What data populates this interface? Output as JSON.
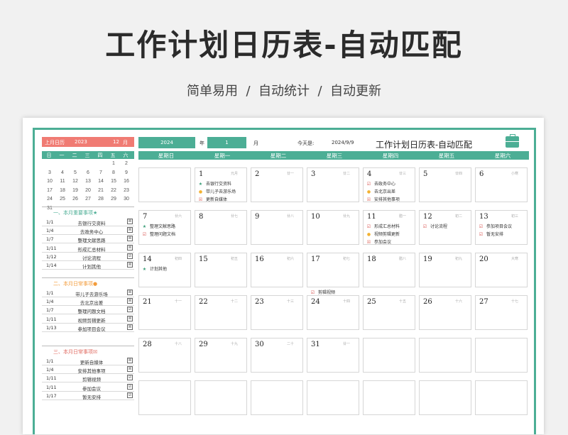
{
  "hero": {
    "title": "工作计划日历表-自动匹配",
    "subtitle": "简单易用  /  自动统计  /  自动更新"
  },
  "mini_calendar": {
    "header_label": "上月日历",
    "header_year": "2023",
    "header_month": "12",
    "header_month_unit": "月",
    "weekdays": [
      "日",
      "一",
      "二",
      "三",
      "四",
      "五",
      "六"
    ],
    "rows": [
      [
        "",
        "",
        "",
        "",
        "",
        "1",
        "2"
      ],
      [
        "3",
        "4",
        "5",
        "6",
        "7",
        "8",
        "9"
      ],
      [
        "10",
        "11",
        "12",
        "13",
        "14",
        "15",
        "16"
      ],
      [
        "17",
        "18",
        "19",
        "20",
        "21",
        "22",
        "23"
      ],
      [
        "24",
        "25",
        "26",
        "27",
        "28",
        "29",
        "30"
      ],
      [
        "31",
        "",
        "",
        "",
        "",
        "",
        ""
      ]
    ]
  },
  "sections": [
    {
      "title": "一、本月重要事项★",
      "color": "#4cae95",
      "items": [
        {
          "date": "1/1",
          "task": "去银行交资料",
          "check": "☒"
        },
        {
          "date": "1/4",
          "task": "去政务中心",
          "check": "☒"
        },
        {
          "date": "1/7",
          "task": "整理文献思路",
          "check": "☒"
        },
        {
          "date": "1/11",
          "task": "形成汇总材料",
          "check": "☒"
        },
        {
          "date": "1/12",
          "task": "讨论流程",
          "check": "☑"
        },
        {
          "date": "1/14",
          "task": "计划其他",
          "check": "☒"
        }
      ]
    },
    {
      "title": "二、本月日常事项●",
      "color": "#f39c3b",
      "items": [
        {
          "date": "1/1",
          "task": "带儿子去游乐场",
          "check": "☒"
        },
        {
          "date": "1/4",
          "task": "去北京出差",
          "check": "☒"
        },
        {
          "date": "1/7",
          "task": "整理问题文档",
          "check": "☑"
        },
        {
          "date": "1/11",
          "task": "视频剪辑更新",
          "check": "☒"
        },
        {
          "date": "1/13",
          "task": "参加项目会议",
          "check": "☒"
        }
      ]
    },
    {
      "title": "三、本月日常事项☒",
      "color": "#e06b62",
      "items": [
        {
          "date": "1/1",
          "task": "更新自媒体",
          "check": "☒"
        },
        {
          "date": "1/4",
          "task": "安排其他事项",
          "check": "☒"
        },
        {
          "date": "1/11",
          "task": "剪辑视频",
          "check": "☑"
        },
        {
          "date": "1/11",
          "task": "参加会议",
          "check": "☑"
        },
        {
          "date": "1/17",
          "task": "暂无安排",
          "check": "☑"
        }
      ]
    }
  ],
  "topbar": {
    "year": "2024",
    "year_unit": "年",
    "month": "1",
    "month_unit": "月",
    "today_label": "今天是:",
    "today_value": "2024/9/9",
    "title": "工作计划日历表-自动匹配"
  },
  "weekdays": [
    "星期日",
    "星期一",
    "星期二",
    "星期三",
    "星期四",
    "星期五",
    "星期六"
  ],
  "weeks": [
    [
      {
        "num": "",
        "lunar": "",
        "events": []
      },
      {
        "num": "1",
        "lunar": "元月",
        "events": [
          {
            "icon": "★",
            "kind": "star",
            "text": "去银行交资料"
          },
          {
            "icon": "●",
            "kind": "dot",
            "text": "带儿子去游乐场"
          },
          {
            "icon": "☒",
            "kind": "x",
            "text": "更新自媒体"
          }
        ]
      },
      {
        "num": "2",
        "lunar": "廿一",
        "events": []
      },
      {
        "num": "3",
        "lunar": "廿二",
        "events": []
      },
      {
        "num": "4",
        "lunar": "廿三",
        "events": [
          {
            "icon": "☑",
            "kind": "chk",
            "text": "去政务中心"
          },
          {
            "icon": "●",
            "kind": "dot",
            "text": "去北京出差"
          },
          {
            "icon": "☒",
            "kind": "x",
            "text": "安排其他事项"
          }
        ]
      },
      {
        "num": "5",
        "lunar": "廿四",
        "events": []
      },
      {
        "num": "6",
        "lunar": "小寒",
        "events": []
      }
    ],
    [
      {
        "num": "7",
        "lunar": "廿六",
        "events": [
          {
            "icon": "★",
            "kind": "star",
            "text": "整理文献思路"
          },
          {
            "icon": "☑",
            "kind": "chk",
            "text": "整理问题文档"
          }
        ]
      },
      {
        "num": "8",
        "lunar": "廿七",
        "events": []
      },
      {
        "num": "9",
        "lunar": "廿八",
        "events": []
      },
      {
        "num": "10",
        "lunar": "廿九",
        "events": []
      },
      {
        "num": "11",
        "lunar": "腊一",
        "events": [
          {
            "icon": "☑",
            "kind": "chk",
            "text": "形成汇总材料"
          },
          {
            "icon": "●",
            "kind": "dot",
            "text": "视频剪辑更新"
          },
          {
            "icon": "☒",
            "kind": "x",
            "text": "参加会议"
          }
        ]
      },
      {
        "num": "12",
        "lunar": "初二",
        "events": [
          {
            "icon": "☑",
            "kind": "chk",
            "text": "讨论流程"
          }
        ]
      },
      {
        "num": "13",
        "lunar": "初三",
        "events": [
          {
            "icon": "☑",
            "kind": "chk",
            "text": "参加项目会议"
          },
          {
            "icon": "☑",
            "kind": "chk",
            "text": "暂无安排"
          }
        ]
      }
    ],
    [
      {
        "num": "14",
        "lunar": "初四",
        "events": [
          {
            "icon": "★",
            "kind": "star",
            "text": "计划其他"
          }
        ]
      },
      {
        "num": "15",
        "lunar": "初五",
        "events": []
      },
      {
        "num": "16",
        "lunar": "初六",
        "events": []
      },
      {
        "num": "17",
        "lunar": "初七",
        "events": [
          {
            "icon": "☑",
            "kind": "chk",
            "text": "剪辑视频",
            "row": 3
          }
        ]
      },
      {
        "num": "18",
        "lunar": "腊八",
        "events": []
      },
      {
        "num": "19",
        "lunar": "初九",
        "events": []
      },
      {
        "num": "20",
        "lunar": "大寒",
        "events": []
      }
    ],
    [
      {
        "num": "21",
        "lunar": "十一",
        "events": []
      },
      {
        "num": "22",
        "lunar": "十二",
        "events": []
      },
      {
        "num": "23",
        "lunar": "十三",
        "events": []
      },
      {
        "num": "24",
        "lunar": "十四",
        "events": []
      },
      {
        "num": "25",
        "lunar": "十五",
        "events": []
      },
      {
        "num": "26",
        "lunar": "十六",
        "events": []
      },
      {
        "num": "27",
        "lunar": "十七",
        "events": []
      }
    ],
    [
      {
        "num": "28",
        "lunar": "十八",
        "events": []
      },
      {
        "num": "29",
        "lunar": "十九",
        "events": []
      },
      {
        "num": "30",
        "lunar": "二十",
        "events": []
      },
      {
        "num": "31",
        "lunar": "廿一",
        "events": []
      },
      {
        "num": "",
        "lunar": "",
        "events": []
      },
      {
        "num": "",
        "lunar": "",
        "events": []
      },
      {
        "num": "",
        "lunar": "",
        "events": []
      }
    ],
    [
      {
        "num": "",
        "lunar": "",
        "events": []
      },
      {
        "num": "",
        "lunar": "",
        "events": []
      },
      {
        "num": "",
        "lunar": "",
        "events": []
      },
      {
        "num": "",
        "lunar": "",
        "events": []
      },
      {
        "num": "",
        "lunar": "",
        "events": []
      },
      {
        "num": "",
        "lunar": "",
        "events": []
      },
      {
        "num": "",
        "lunar": "",
        "events": []
      }
    ]
  ]
}
